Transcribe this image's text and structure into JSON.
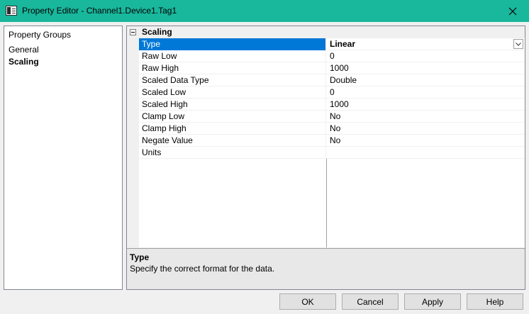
{
  "window": {
    "title": "Property Editor - Channel1.Device1.Tag1",
    "app_icon": "window-icon",
    "close_icon": "close-icon"
  },
  "groups": {
    "header": "Property Groups",
    "items": [
      {
        "label": "General",
        "selected": false
      },
      {
        "label": "Scaling",
        "selected": true
      }
    ]
  },
  "grid": {
    "category": {
      "label": "Scaling",
      "toggle_icon": "collapse-minus-icon"
    },
    "properties": [
      {
        "name": "Type",
        "value": "Linear",
        "selected": true,
        "dropdown": true
      },
      {
        "name": "Raw Low",
        "value": "0"
      },
      {
        "name": "Raw High",
        "value": "1000"
      },
      {
        "name": "Scaled Data Type",
        "value": "Double"
      },
      {
        "name": "Scaled Low",
        "value": "0"
      },
      {
        "name": "Scaled High",
        "value": "1000"
      },
      {
        "name": "Clamp Low",
        "value": "No"
      },
      {
        "name": "Clamp High",
        "value": "No"
      },
      {
        "name": "Negate Value",
        "value": "No"
      },
      {
        "name": "Units",
        "value": ""
      }
    ]
  },
  "help": {
    "title": "Type",
    "description": "Specify the correct format for the data."
  },
  "buttons": {
    "ok": "OK",
    "cancel": "Cancel",
    "apply": "Apply",
    "help": "Help"
  },
  "colors": {
    "titlebar": "#19b79c",
    "selection": "#0078d7"
  }
}
